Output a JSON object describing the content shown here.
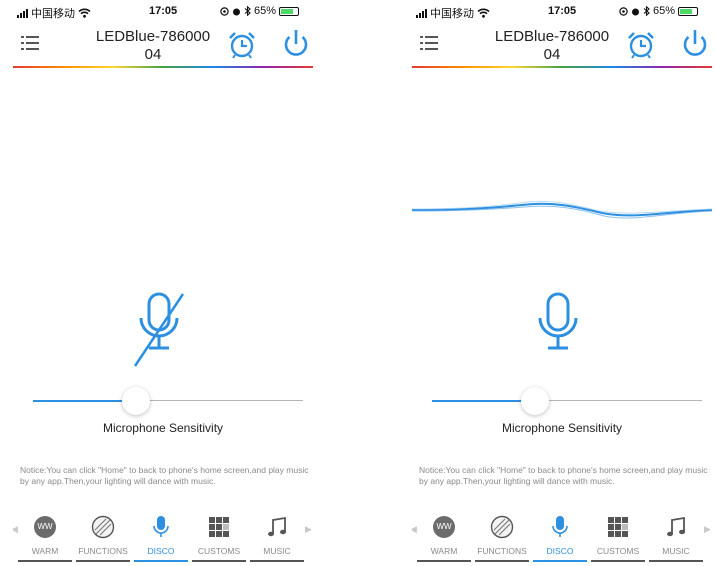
{
  "phones": [
    {
      "status": {
        "carrier": "中国移动",
        "time": "17:05",
        "battery": "65%"
      },
      "header": {
        "title_line1": "LEDBlue-786000",
        "title_line2": "04"
      },
      "mic_state": "muted",
      "slider": {
        "label": "Microphone Sensitivity",
        "value_fraction": 0.38
      },
      "notice": "Notice:You can click \"Home\" to back to phone's home screen,and play music by any app.Then,your lighting will dance with music.",
      "tabs": [
        {
          "label": "WARM",
          "icon": "ww-icon",
          "active": false
        },
        {
          "label": "FUNCTIONS",
          "icon": "pattern-icon",
          "active": false
        },
        {
          "label": "DISCO",
          "icon": "microphone-icon",
          "active": true
        },
        {
          "label": "CUSTOMS",
          "icon": "grid-icon",
          "active": false
        },
        {
          "label": "MUSIC",
          "icon": "music-note-icon",
          "active": false
        }
      ],
      "tab_ww_text": "WW"
    },
    {
      "status": {
        "carrier": "中国移动",
        "time": "17:05",
        "battery": "65%"
      },
      "header": {
        "title_line1": "LEDBlue-786000",
        "title_line2": "04"
      },
      "mic_state": "active",
      "slider": {
        "label": "Microphone Sensitivity",
        "value_fraction": 0.38
      },
      "notice": "Notice:You can click \"Home\" to back to phone's home screen,and play music by any app.Then,your lighting will dance with music.",
      "tabs": [
        {
          "label": "WARM",
          "icon": "ww-icon",
          "active": false
        },
        {
          "label": "FUNCTIONS",
          "icon": "pattern-icon",
          "active": false
        },
        {
          "label": "DISCO",
          "icon": "microphone-icon",
          "active": true
        },
        {
          "label": "CUSTOMS",
          "icon": "grid-icon",
          "active": false
        },
        {
          "label": "MUSIC",
          "icon": "music-note-icon",
          "active": false
        }
      ],
      "tab_ww_text": "WW"
    }
  ],
  "colors": {
    "accent": "#2d8fe0",
    "tab_inactive": "#8a8a8a"
  }
}
